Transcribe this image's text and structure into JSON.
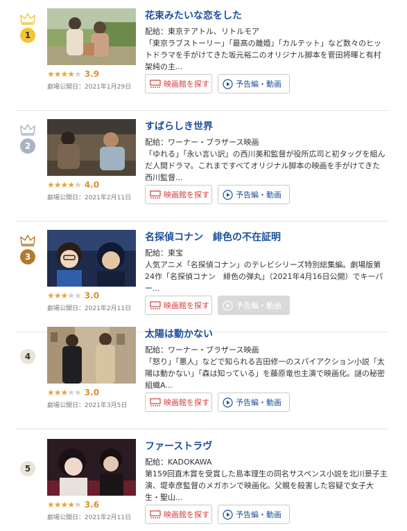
{
  "theme": {
    "title_color": "#1b4f9c",
    "theater_color": "#d73a3a",
    "star_color": "#e6a43c",
    "score_color": "#e38b2e",
    "rank_gold": "#f3c536",
    "rank_silver": "#a8b3c4",
    "rank_bronze": "#b7772e",
    "rank_plain": "#e8e4d8"
  },
  "buttons": {
    "theater_label": "映画館を探す",
    "trailer_label": "予告編・動画",
    "theater_icon": "theater-screen-icon",
    "trailer_icon": "play-circle-icon"
  },
  "movies": [
    {
      "rank": "1",
      "crown": "gold",
      "title": "花束みたいな恋をした",
      "distributor": "配給：東京テアトル、リトルモア",
      "description": "「東京ラブストーリー」「最高の離婚」「カルテット」など数々のヒットドラマを手がけてきた坂元裕二のオリジナル脚本を菅田将暉と有村架純の主...",
      "rating": 3.9,
      "score_text": "3.9",
      "release": "劇場公開日：2021年1月29日",
      "trailer_available": true
    },
    {
      "rank": "2",
      "crown": "silver",
      "title": "すばらしき世界",
      "distributor": "配給：ワーナー・ブラザース映画",
      "description": "「ゆれる」「永い言い訳」の西川美和監督が役所広司と初タッグを組んだ人間ドラマ。これまですべてオリジナル脚本の映画を手がけてきた西川監督...",
      "rating": 4.0,
      "score_text": "4.0",
      "release": "劇場公開日：2021年2月11日",
      "trailer_available": true
    },
    {
      "rank": "3",
      "crown": "bronze",
      "title": "名探偵コナン　緋色の不在証明",
      "distributor": "配給：東宝",
      "description": "人気アニメ「名探偵コナン」のテレビシリーズ特別総集編。劇場版第24作「名探偵コナン　緋色の弾丸」（2021年4月16日公開）でキーパー...",
      "rating": 3.0,
      "score_text": "3.0",
      "release": "劇場公開日：2021年2月11日",
      "trailer_available": false
    },
    {
      "rank": "4",
      "crown": "none",
      "title": "太陽は動かない",
      "distributor": "配給：ワーナー・ブラザース映画",
      "description": "「怒り」「悪人」などで知られる吉田修一のスパイアクション小説「太陽は動かない」「森は知っている」を藤原竜也主演で映画化。謎の秘密組織A...",
      "rating": 3.0,
      "score_text": "3.0",
      "release": "劇場公開日：2021年3月5日",
      "trailer_available": true
    },
    {
      "rank": "5",
      "crown": "none",
      "title": "ファーストラヴ",
      "distributor": "配給：KADOKAWA",
      "description": "第159回直木賞を受賞した島本理生の同名サスペンス小説を北川景子主演、堤幸彦監督のメガホンで映画化。父親を殺害した容疑で女子大生・聖山...",
      "rating": 3.6,
      "score_text": "3.6",
      "release": "劇場公開日：2021年2月11日",
      "trailer_available": true
    }
  ]
}
